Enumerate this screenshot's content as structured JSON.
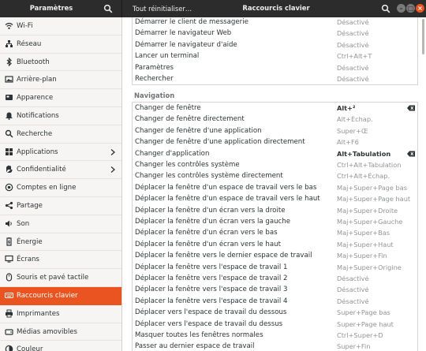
{
  "header": {
    "left_title": "Paramètres",
    "reset_label": "Tout réinitialiser…",
    "right_title": "Raccourcis clavier",
    "window_buttons": [
      "minimize",
      "maximize",
      "close"
    ]
  },
  "sidebar": {
    "items": [
      {
        "label": "Wi-Fi",
        "icon": "wifi-icon"
      },
      {
        "label": "Réseau",
        "icon": "network-icon"
      },
      {
        "label": "Bluetooth",
        "icon": "bluetooth-icon"
      },
      {
        "label": "Arrière-plan",
        "icon": "background-icon"
      },
      {
        "label": "Apparence",
        "icon": "appearance-icon"
      },
      {
        "label": "Notifications",
        "icon": "bell-icon"
      },
      {
        "label": "Recherche",
        "icon": "search-icon"
      },
      {
        "label": "Applications",
        "icon": "applications-icon",
        "chevron": true
      },
      {
        "label": "Confidentialité",
        "icon": "privacy-icon",
        "chevron": true
      },
      {
        "label": "Comptes en ligne",
        "icon": "online-accounts-icon"
      },
      {
        "label": "Partage",
        "icon": "share-icon"
      },
      {
        "label": "Son",
        "icon": "speaker-icon"
      },
      {
        "label": "Énergie",
        "icon": "power-icon"
      },
      {
        "label": "Écrans",
        "icon": "display-icon"
      },
      {
        "label": "Souris et pavé tactile",
        "icon": "mouse-icon"
      },
      {
        "label": "Raccourcis clavier",
        "icon": "keyboard-icon",
        "active": true
      },
      {
        "label": "Imprimantes",
        "icon": "printer-icon"
      },
      {
        "label": "Médias amovibles",
        "icon": "removable-media-icon"
      },
      {
        "label": "Couleur",
        "icon": "color-icon"
      }
    ]
  },
  "top_group": [
    {
      "name": "Démarrer le client de messagerie",
      "accel": "Désactivé"
    },
    {
      "name": "Démarrer le navigateur Web",
      "accel": "Désactivé"
    },
    {
      "name": "Démarrer le navigateur d'aide",
      "accel": "Désactivé"
    },
    {
      "name": "Lancer un terminal",
      "accel": "Ctrl+Alt+T"
    },
    {
      "name": "Paramètres",
      "accel": "Désactivé"
    },
    {
      "name": "Rechercher",
      "accel": "Désactivé"
    }
  ],
  "navigation": {
    "title": "Navigation",
    "rows": [
      {
        "name": "Changer de fenêtre",
        "accel": "Alt+²",
        "custom": true
      },
      {
        "name": "Changer de fenêtre directement",
        "accel": "Alt+Échap."
      },
      {
        "name": "Changer de fenêtre d'une application",
        "accel": "Super+Œ"
      },
      {
        "name": "Changer de fenêtre d'une application directement",
        "accel": "Alt+F6"
      },
      {
        "name": "Changer d'application",
        "accel": "Alt+Tabulation",
        "custom": true
      },
      {
        "name": "Changer les contrôles système",
        "accel": "Ctrl+Alt+Tabulation"
      },
      {
        "name": "Changer les contrôles système directement",
        "accel": "Ctrl+Alt+Échap."
      },
      {
        "name": "Déplacer la fenêtre d'un espace de travail vers le bas",
        "accel": "Maj+Super+Page bas"
      },
      {
        "name": "Déplacer la fenêtre d'un espace de travail vers le haut",
        "accel": "Maj+Super+Page haut"
      },
      {
        "name": "Déplacer la fenêtre d'un écran vers la droite",
        "accel": "Maj+Super+Droite"
      },
      {
        "name": "Déplacer la fenêtre d'un écran vers la gauche",
        "accel": "Maj+Super+Gauche"
      },
      {
        "name": "Déplacer la fenêtre d'un écran vers le bas",
        "accel": "Maj+Super+Bas"
      },
      {
        "name": "Déplacer la fenêtre d'un écran vers le haut",
        "accel": "Maj+Super+Haut"
      },
      {
        "name": "Déplacer la fenêtre vers le dernier espace de travail",
        "accel": "Maj+Super+Fin"
      },
      {
        "name": "Déplacer la fenêtre vers l'espace de travail 1",
        "accel": "Maj+Super+Origine"
      },
      {
        "name": "Déplacer la fenêtre vers l'espace de travail 2",
        "accel": "Désactivé"
      },
      {
        "name": "Déplacer la fenêtre vers l'espace de travail 3",
        "accel": "Désactivé"
      },
      {
        "name": "Déplacer la fenêtre vers l'espace de travail 4",
        "accel": "Désactivé"
      },
      {
        "name": "Déplacer vers l'espace de travail du dessous",
        "accel": "Super+Page bas"
      },
      {
        "name": "Déplacer vers l'espace de travail du dessus",
        "accel": "Super+Page haut"
      },
      {
        "name": "Masquer toutes les fenêtres normales",
        "accel": "Ctrl+Super+D"
      },
      {
        "name": "Passer au dernier espace de travail",
        "accel": "Super+Fin"
      }
    ]
  },
  "colors": {
    "accent": "#e95420",
    "header": "#2c2c2c",
    "muted": "#929595"
  }
}
